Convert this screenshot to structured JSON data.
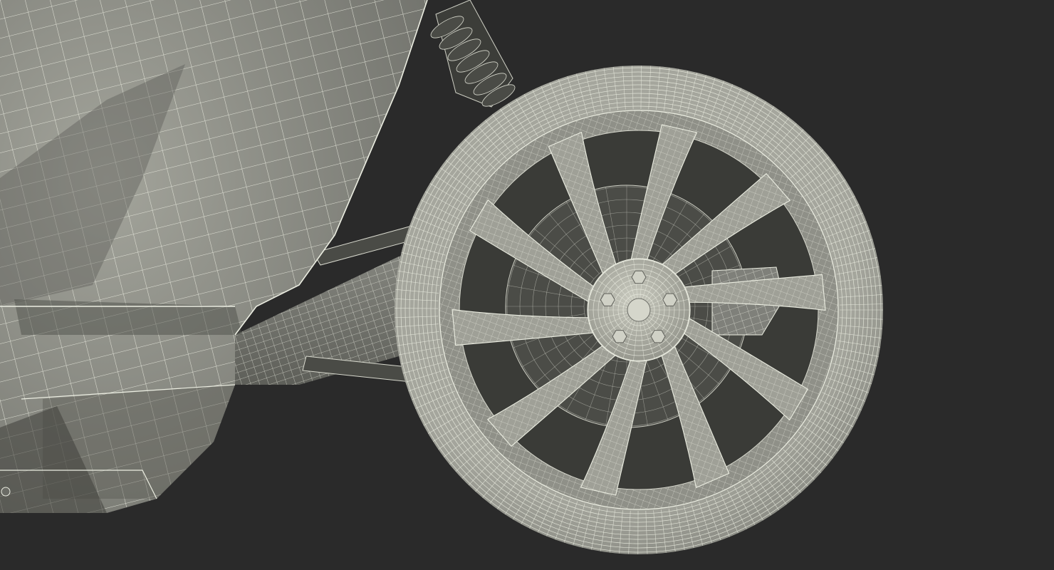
{
  "scene": {
    "background_color": "#2a2a2a",
    "mesh_fill_color": "#8e8f86",
    "mesh_shadow_color": "#5d5e58",
    "wire_color": "#eceee2",
    "dark_part_color": "#3a3b37",
    "wheel": {
      "spoke_count": 10,
      "lug_nut_count": 5,
      "subject": "wheel"
    }
  }
}
